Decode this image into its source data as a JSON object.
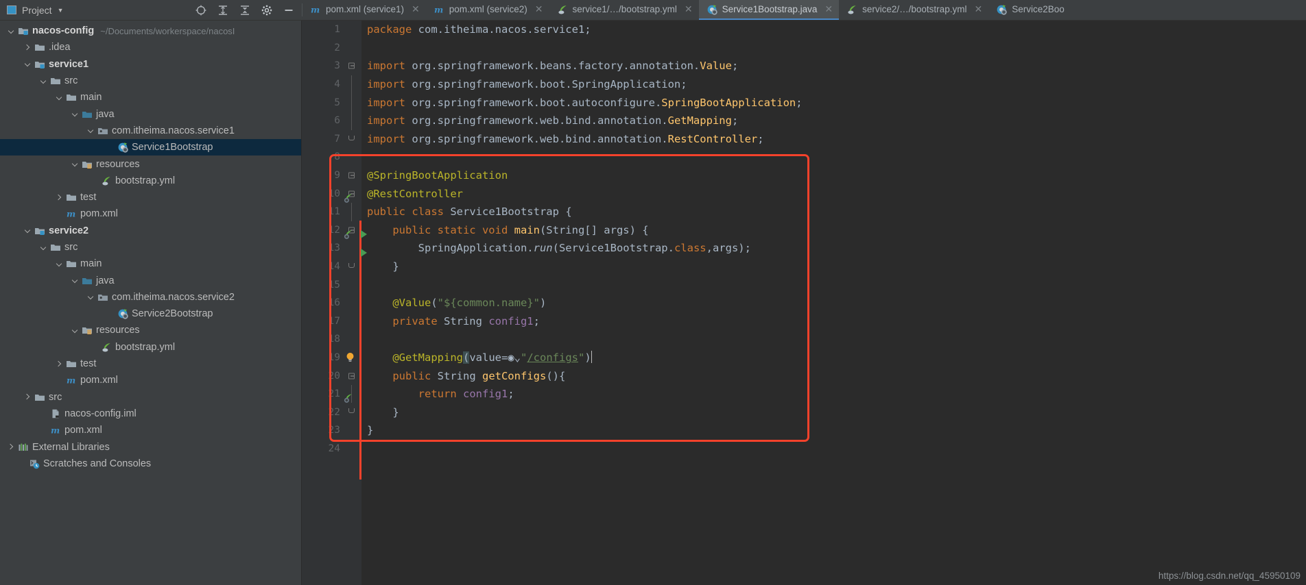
{
  "project_panel": {
    "title": "Project",
    "icon": "project-window-icon",
    "toolbar": [
      {
        "name": "locate-icon",
        "label": "Select Opened File"
      },
      {
        "name": "expand-all-icon",
        "label": "Expand All"
      },
      {
        "name": "collapse-all-icon",
        "label": "Collapse All"
      },
      {
        "name": "gear-icon",
        "label": "Settings"
      },
      {
        "name": "minimize-icon",
        "label": "Hide"
      }
    ],
    "tree": [
      {
        "label": "nacos-config",
        "path": "~/Documents/workerspace/nacosI",
        "icon": "module-folder-icon",
        "indent": 0,
        "arrow": "down",
        "bold": true
      },
      {
        "label": ".idea",
        "icon": "folder-icon",
        "indent": 1,
        "arrow": "right",
        "bold": false
      },
      {
        "label": "service1",
        "icon": "module-folder-icon",
        "indent": 1,
        "arrow": "down",
        "bold": true
      },
      {
        "label": "src",
        "icon": "folder-icon",
        "indent": 2,
        "arrow": "down",
        "bold": false
      },
      {
        "label": "main",
        "icon": "folder-icon",
        "indent": 3,
        "arrow": "down",
        "bold": false
      },
      {
        "label": "java",
        "icon": "source-root-icon",
        "indent": 4,
        "arrow": "down",
        "bold": false
      },
      {
        "label": "com.itheima.nacos.service1",
        "icon": "package-icon",
        "indent": 5,
        "arrow": "down",
        "bold": false
      },
      {
        "label": "Service1Bootstrap",
        "icon": "spring-class-icon",
        "indent": 6,
        "arrow": "none",
        "bold": false,
        "selected": true
      },
      {
        "label": "resources",
        "icon": "resources-folder-icon",
        "indent": 4,
        "arrow": "down",
        "bold": false
      },
      {
        "label": "bootstrap.yml",
        "icon": "spring-yml-icon",
        "indent": 5,
        "arrow": "none",
        "bold": false
      },
      {
        "label": "test",
        "icon": "folder-icon",
        "indent": 3,
        "arrow": "right",
        "bold": false
      },
      {
        "label": "pom.xml",
        "icon": "maven-icon",
        "indent": 3,
        "arrow": "none",
        "bold": false
      },
      {
        "label": "service2",
        "icon": "module-folder-icon",
        "indent": 1,
        "arrow": "down",
        "bold": true
      },
      {
        "label": "src",
        "icon": "folder-icon",
        "indent": 2,
        "arrow": "down",
        "bold": false
      },
      {
        "label": "main",
        "icon": "folder-icon",
        "indent": 3,
        "arrow": "down",
        "bold": false
      },
      {
        "label": "java",
        "icon": "source-root-icon",
        "indent": 4,
        "arrow": "down",
        "bold": false
      },
      {
        "label": "com.itheima.nacos.service2",
        "icon": "package-icon",
        "indent": 5,
        "arrow": "down",
        "bold": false
      },
      {
        "label": "Service2Bootstrap",
        "icon": "spring-class-icon",
        "indent": 6,
        "arrow": "none",
        "bold": false
      },
      {
        "label": "resources",
        "icon": "resources-folder-icon",
        "indent": 4,
        "arrow": "down",
        "bold": false
      },
      {
        "label": "bootstrap.yml",
        "icon": "spring-yml-icon",
        "indent": 5,
        "arrow": "none",
        "bold": false
      },
      {
        "label": "test",
        "icon": "folder-icon",
        "indent": 3,
        "arrow": "right",
        "bold": false
      },
      {
        "label": "pom.xml",
        "icon": "maven-icon",
        "indent": 3,
        "arrow": "none",
        "bold": false
      },
      {
        "label": "src",
        "icon": "folder-icon",
        "indent": 1,
        "arrow": "right",
        "bold": false
      },
      {
        "label": "nacos-config.iml",
        "icon": "iml-file-icon",
        "indent": 2,
        "arrow": "none",
        "bold": false
      },
      {
        "label": "pom.xml",
        "icon": "maven-icon",
        "indent": 2,
        "arrow": "none",
        "bold": false
      },
      {
        "label": "External Libraries",
        "icon": "libraries-icon",
        "indent": 0,
        "arrow": "right",
        "bold": false
      },
      {
        "label": "Scratches and Consoles",
        "icon": "scratches-icon",
        "indent": 0,
        "arrow": "none",
        "bold": false
      }
    ]
  },
  "tabs": [
    {
      "label": "pom.xml (service1)",
      "icon": "maven-icon",
      "active": false,
      "closable": true
    },
    {
      "label": "pom.xml (service2)",
      "icon": "maven-icon",
      "active": false,
      "closable": true
    },
    {
      "label": "service1/…/bootstrap.yml",
      "icon": "spring-yml-icon",
      "active": false,
      "closable": true
    },
    {
      "label": "Service1Bootstrap.java",
      "icon": "spring-class-icon",
      "active": true,
      "closable": true
    },
    {
      "label": "service2/…/bootstrap.yml",
      "icon": "spring-yml-icon",
      "active": false,
      "closable": true
    },
    {
      "label": "Service2Boo",
      "icon": "spring-class-icon",
      "active": false,
      "closable": false
    }
  ],
  "editor": {
    "file": "Service1Bootstrap.java",
    "first_line": 1,
    "last_line": 24,
    "lines": [
      {
        "n": 1,
        "text": "package com.itheima.nacos.service1;"
      },
      {
        "n": 2,
        "text": ""
      },
      {
        "n": 3,
        "text": "import org.springframework.beans.factory.annotation.Value;"
      },
      {
        "n": 4,
        "text": "import org.springframework.boot.SpringApplication;"
      },
      {
        "n": 5,
        "text": "import org.springframework.boot.autoconfigure.SpringBootApplication;"
      },
      {
        "n": 6,
        "text": "import org.springframework.web.bind.annotation.GetMapping;"
      },
      {
        "n": 7,
        "text": "import org.springframework.web.bind.annotation.RestController;"
      },
      {
        "n": 8,
        "text": ""
      },
      {
        "n": 9,
        "text": "@SpringBootApplication"
      },
      {
        "n": 10,
        "text": "@RestController"
      },
      {
        "n": 11,
        "text": "public class Service1Bootstrap {"
      },
      {
        "n": 12,
        "text": "    public static void main(String[] args) {"
      },
      {
        "n": 13,
        "text": "        SpringApplication.run(Service1Bootstrap.class,args);"
      },
      {
        "n": 14,
        "text": "    }"
      },
      {
        "n": 15,
        "text": ""
      },
      {
        "n": 16,
        "text": "    @Value(\"${common.name}\")"
      },
      {
        "n": 17,
        "text": "    private String config1;"
      },
      {
        "n": 18,
        "text": ""
      },
      {
        "n": 19,
        "text": "    @GetMapping(value=\"/configs\")"
      },
      {
        "n": 20,
        "text": "    public String getConfigs(){"
      },
      {
        "n": 21,
        "text": "        return config1;"
      },
      {
        "n": 22,
        "text": "    }"
      },
      {
        "n": 23,
        "text": "}"
      },
      {
        "n": 24,
        "text": ""
      }
    ],
    "gutter_markers": [
      {
        "line": 9,
        "icon": "spring-bean-icon"
      },
      {
        "line": 11,
        "icon": "spring-bean-icon"
      },
      {
        "line": 11,
        "icon": "run-gutter-icon"
      },
      {
        "line": 12,
        "icon": "run-gutter-icon"
      },
      {
        "line": 19,
        "icon": "intention-bulb-icon"
      },
      {
        "line": 20,
        "icon": "spring-bean-icon"
      }
    ],
    "annotation_value": "@GetMapping(value=\"/configs\")",
    "url_mapping": "/configs"
  },
  "watermark": "https://blog.csdn.net/qq_45950109",
  "colors": {
    "background": "#2b2b2b",
    "panel": "#3c3f41",
    "selection": "#0d293e",
    "accent": "#4a88c7",
    "keyword": "#cc7832",
    "string": "#6a8759",
    "annotation": "#bbb529",
    "field": "#9876aa",
    "method": "#ffc66d",
    "highlight_box": "#f4422b"
  }
}
